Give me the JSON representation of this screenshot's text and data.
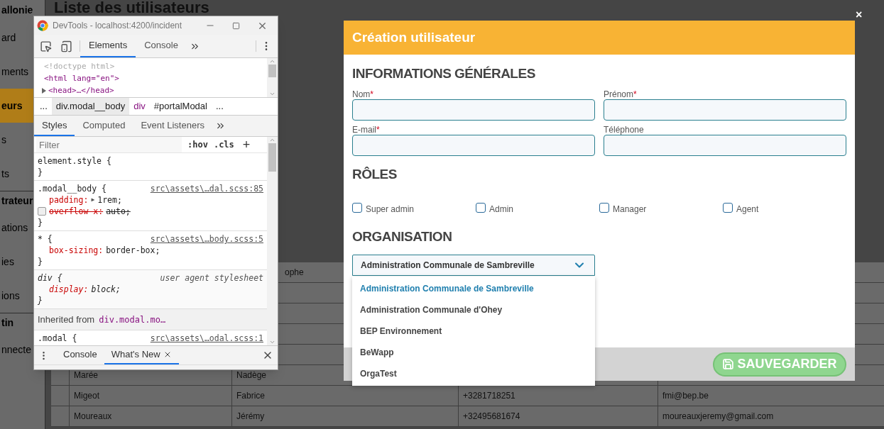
{
  "background_page": {
    "sidebar": {
      "logo": "allonie",
      "items": [
        {
          "label": "ard",
          "kind": "item",
          "selected": false
        },
        {
          "label": "ments",
          "kind": "item",
          "selected": false
        },
        {
          "label": "eurs",
          "kind": "item",
          "selected": true
        },
        {
          "label": "s",
          "kind": "item",
          "selected": false
        },
        {
          "label": "ts",
          "kind": "item",
          "selected": false
        },
        {
          "label": "trateur",
          "kind": "section",
          "selected": false
        },
        {
          "label": "ations",
          "kind": "item",
          "selected": false
        },
        {
          "label": "ies",
          "kind": "item",
          "selected": false
        },
        {
          "label": "ions",
          "kind": "item",
          "selected": false
        },
        {
          "label": "tin",
          "kind": "section",
          "selected": false
        },
        {
          "label": "nnecte",
          "kind": "item",
          "selected": false
        }
      ]
    },
    "page_title": "Liste des utilisateurs",
    "table": {
      "rows_upper": [
        {
          "first_name": "ophe"
        }
      ],
      "rows_lower": [
        {
          "last_name": "Marée",
          "first_name": "Nadège"
        },
        {
          "last_name": "Migeot",
          "first_name": "Fabrice",
          "phone": "+3281718251",
          "email": "fmi@bep.be"
        },
        {
          "last_name": "Moureaux",
          "first_name": "Jérémy",
          "phone": "+32495681674",
          "email": "moureauxjeremy@gmail.com"
        }
      ]
    }
  },
  "devtools": {
    "title": "DevTools - localhost:4200/incident",
    "main_tabs": [
      {
        "label": "Elements",
        "selected": true
      },
      {
        "label": "Console",
        "selected": false
      }
    ],
    "dom_lines": [
      {
        "kind": "doctype",
        "text": "<!doctype html>"
      },
      {
        "kind": "open",
        "text": "<html lang=\"en\">"
      },
      {
        "kind": "collapsed",
        "text": "<head>…</head>"
      }
    ],
    "breadcrumbs": [
      {
        "label": "...",
        "kind": "plain",
        "selected": false
      },
      {
        "label": "div.modal__body",
        "kind": "plain",
        "selected": true
      },
      {
        "label": "div",
        "kind": "tag",
        "selected": false
      },
      {
        "label": "#portalModal",
        "kind": "plain",
        "selected": false
      },
      {
        "label": "...",
        "kind": "plain",
        "selected": false
      }
    ],
    "style_tabs": [
      {
        "label": "Styles",
        "selected": true
      },
      {
        "label": "Computed",
        "selected": false
      },
      {
        "label": "Event Listeners",
        "selected": false
      }
    ],
    "filter": {
      "placeholder": "Filter"
    },
    "hov": ":hov",
    "cls": ".cls",
    "add": "+",
    "rules": [
      {
        "kind": "rule",
        "selector": "element.style {",
        "closing": "}"
      },
      {
        "kind": "rule",
        "selector": ".modal__body {",
        "source": "src\\assets\\…dal.scss:85",
        "declarations": [
          {
            "property": "padding:",
            "expand_toggle": "▶",
            "value": "1rem;",
            "disabled": false
          },
          {
            "property": "overflow-x:",
            "value": "auto;",
            "disabled": true
          }
        ],
        "closing": "}"
      },
      {
        "kind": "rule",
        "selector": "* {",
        "source": "src\\assets\\…body.scss:5",
        "declarations": [
          {
            "property": "box-sizing:",
            "value": "border-box;",
            "disabled": false
          }
        ],
        "closing": "}"
      },
      {
        "kind": "user_agent",
        "selector": "div {",
        "source": "user agent stylesheet",
        "declarations": [
          {
            "property": "display:",
            "value": "block;",
            "disabled": false
          }
        ],
        "closing": "}"
      },
      {
        "kind": "inherited",
        "label": "Inherited from",
        "selector": "div.modal.mo…"
      },
      {
        "kind": "rule",
        "selector": ".modal {",
        "source": "src\\assets\\…odal.scss:1"
      }
    ],
    "drawer_tabs": [
      {
        "label": "Console",
        "selected": false,
        "closable": false
      },
      {
        "label": "What's New",
        "selected": true,
        "closable": true
      }
    ]
  },
  "modal": {
    "close": "×",
    "title": "Création utilisateur",
    "required_mark": "*",
    "general": {
      "heading": "INFORMATIONS GÉNÉRALES",
      "fields": [
        {
          "label": "Nom",
          "required": true
        },
        {
          "label": "Prénom",
          "required": true
        },
        {
          "label": "E-mail",
          "required": true
        },
        {
          "label": "Téléphone",
          "required": false
        }
      ]
    },
    "roles": {
      "heading": "RÔLES",
      "options": [
        {
          "label": "Super admin",
          "checked": false
        },
        {
          "label": "Admin",
          "checked": false
        },
        {
          "label": "Manager",
          "checked": false
        },
        {
          "label": "Agent",
          "checked": false
        }
      ]
    },
    "organisation": {
      "heading": "ORGANISATION",
      "select": {
        "value": "Administration Communale de Sambreville",
        "expanded": true,
        "options": [
          {
            "label": "Administration Communale de Sambreville",
            "selected": true
          },
          {
            "label": "Administration Communale d'Ohey",
            "selected": false
          },
          {
            "label": "BEP Environnement",
            "selected": false
          },
          {
            "label": "BeWapp",
            "selected": false
          },
          {
            "label": "OrgaTest",
            "selected": false
          }
        ]
      }
    },
    "save_button": "SAUVEGARDER"
  }
}
